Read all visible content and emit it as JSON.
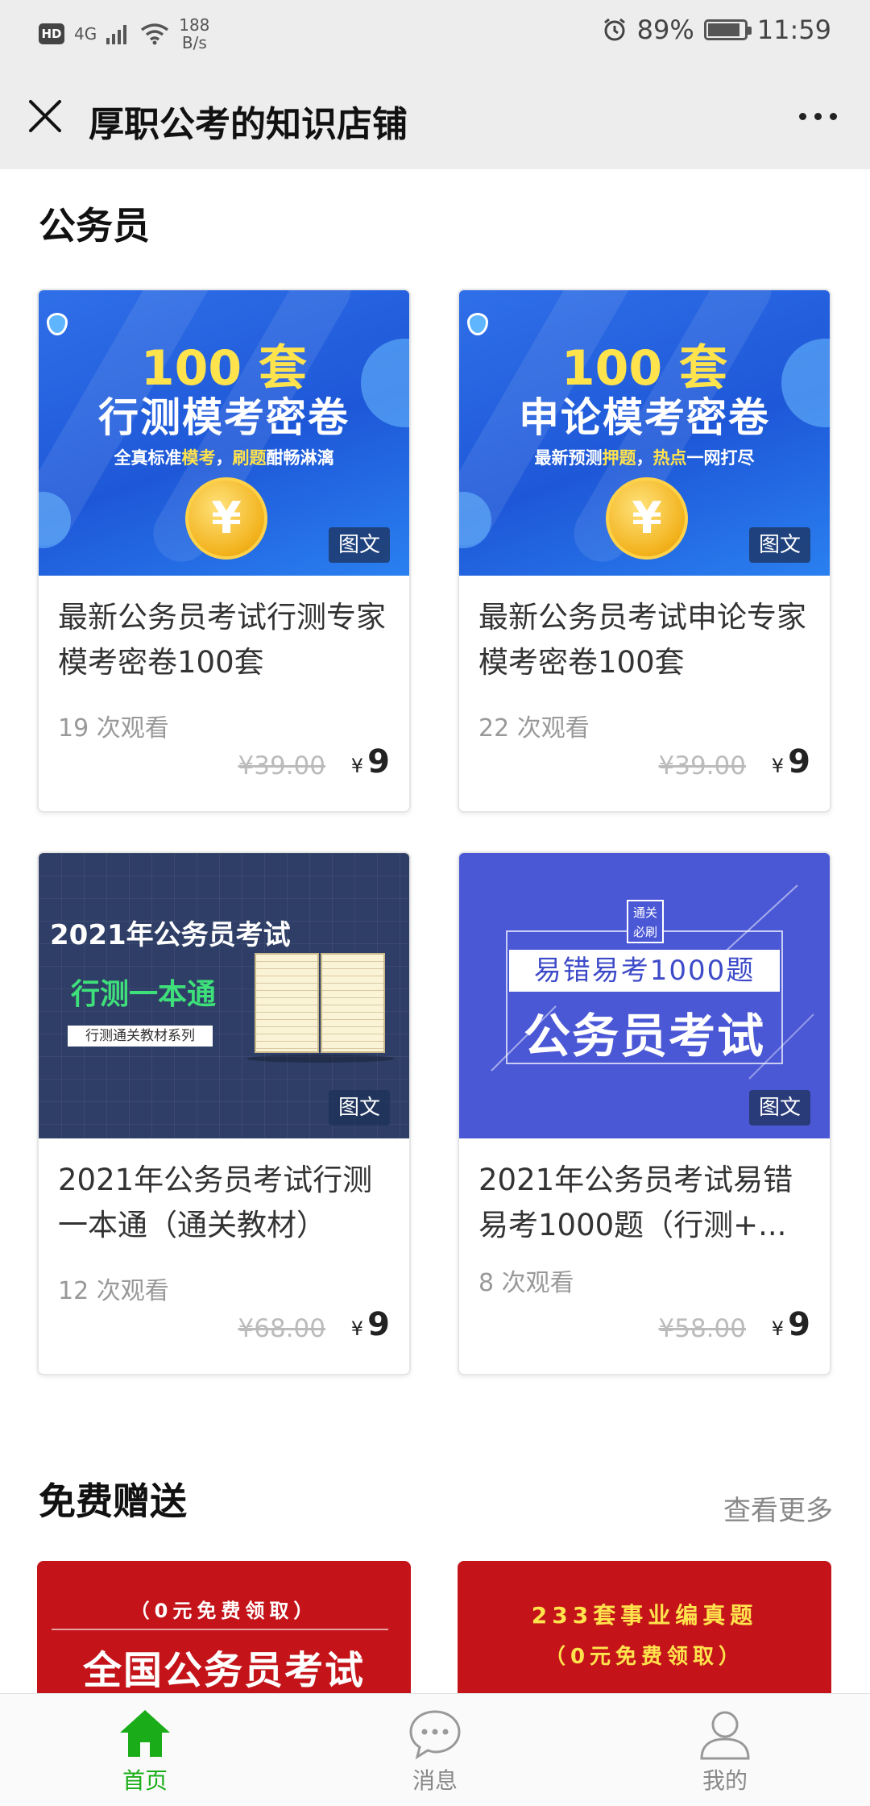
{
  "status_bar": {
    "hd": "HD",
    "network": "4G",
    "speed_value": "188",
    "speed_unit": "B/s",
    "battery_percent": "89%",
    "battery_level": 0.89,
    "time": "11:59"
  },
  "nav": {
    "title": "厚职公考的知识店铺"
  },
  "section_civil": {
    "title": "公务员",
    "cards": [
      {
        "image": {
          "line1": "100 套",
          "line2": "行测模考密卷",
          "line3_a": "全真标准",
          "line3_b": "模考",
          "line3_c": "，",
          "line3_d": "刷题",
          "line3_e": "酣畅淋漓",
          "coin": "¥"
        },
        "tag": "图文",
        "title": "最新公务员考试行测专家模考密卷100套",
        "views": "19 次观看",
        "old_price": "¥39.00",
        "currency": "¥",
        "price": "9"
      },
      {
        "image": {
          "line1": "100 套",
          "line2": "申论模考密卷",
          "line3_a": "最新预测",
          "line3_b": "押题",
          "line3_c": "，",
          "line3_d": "热点",
          "line3_e": "一网打尽",
          "coin": "¥"
        },
        "tag": "图文",
        "title": "最新公务员考试申论专家模考密卷100套",
        "views": "22 次观看",
        "old_price": "¥39.00",
        "currency": "¥",
        "price": "9"
      },
      {
        "image": {
          "line1": "2021年公务员考试",
          "line2": "行测一本通",
          "line3": "行测通关教材系列"
        },
        "tag": "图文",
        "title": "2021年公务员考试行测一本通（通关教材）",
        "views": "12 次观看",
        "old_price": "¥68.00",
        "currency": "¥",
        "price": "9"
      },
      {
        "image": {
          "badge_top": "通关",
          "badge_bottom": "必刷",
          "line2": "易错易考1000题",
          "line1": "公务员考试"
        },
        "tag": "图文",
        "title": "2021年公务员考试易错易考1000题（行测+...",
        "views": "8 次观看",
        "old_price": "¥58.00",
        "currency": "¥",
        "price": "9"
      }
    ]
  },
  "section_free": {
    "title": "免费赠送",
    "more": "查看更多",
    "cards": [
      {
        "line1": "（0元免费领取）",
        "big": "全国公务员考试"
      },
      {
        "line1": "233套事业编真题",
        "line2": "（0元免费领取）"
      }
    ]
  },
  "tabbar": {
    "items": [
      {
        "label": "首页",
        "icon": "home-icon",
        "active": true
      },
      {
        "label": "消息",
        "icon": "message-icon",
        "active": false
      },
      {
        "label": "我的",
        "icon": "profile-icon",
        "active": false
      }
    ]
  },
  "colors": {
    "accent": "#1aad19",
    "promo_blue": "#2f6fe8",
    "promo_navy": "#2f3e66",
    "promo_purple": "#4b58d6",
    "promo_red": "#c4141a"
  }
}
